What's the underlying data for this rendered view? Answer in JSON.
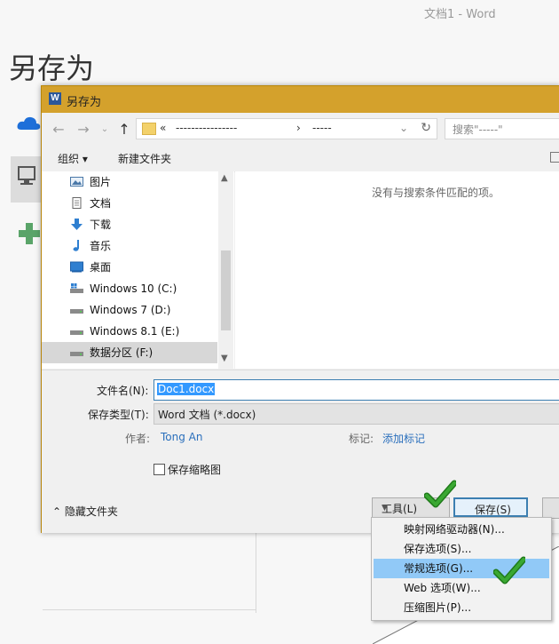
{
  "backstage": {
    "window_title": "文档1 - Word",
    "heading": "另存为"
  },
  "dialog": {
    "title": "另存为",
    "app_icon_letter": "W",
    "address": {
      "lead": "«",
      "crumb1": "----------------",
      "sep": "›",
      "crumb2": "-----"
    },
    "search_placeholder": "搜索\"-----\"",
    "toolbar": {
      "organize": "组织 ▾",
      "new_folder": "新建文件夹"
    },
    "nav_items": [
      {
        "label": "图片",
        "icon": "pictures-icon"
      },
      {
        "label": "文档",
        "icon": "documents-icon"
      },
      {
        "label": "下载",
        "icon": "downloads-icon"
      },
      {
        "label": "音乐",
        "icon": "music-icon"
      },
      {
        "label": "桌面",
        "icon": "desktop-icon"
      },
      {
        "label": "Windows 10 (C:)",
        "icon": "system-drive-icon"
      },
      {
        "label": "Windows 7 (D:)",
        "icon": "drive-icon"
      },
      {
        "label": "Windows 8.1 (E:)",
        "icon": "drive-icon"
      },
      {
        "label": "数据分区 (F:)",
        "icon": "drive-icon",
        "selected": true
      }
    ],
    "empty_message": "没有与搜索条件匹配的项。",
    "form": {
      "filename_label": "文件名(N):",
      "filename_value": "Doc1.docx",
      "filetype_label": "保存类型(T):",
      "filetype_value": "Word 文档 (*.docx)",
      "author_label": "作者:",
      "author_value": "Tong An",
      "tags_label": "标记:",
      "tags_value": "添加标记",
      "thumbnail_label": "保存缩略图",
      "thumbnail_checked": false
    },
    "hide_folders": "隐藏文件夹",
    "tools_button": "工具(L)",
    "save_button": "保存(S)"
  },
  "tools_menu": {
    "items": [
      {
        "label": "映射网络驱动器(N)..."
      },
      {
        "label": "保存选项(S)..."
      },
      {
        "label": "常规选项(G)...",
        "highlighted": true
      },
      {
        "label": "Web 选项(W)..."
      },
      {
        "label": "压缩图片(P)..."
      }
    ]
  },
  "colors": {
    "titlebar": "#d4a12c",
    "accent": "#3c7fb1",
    "selection": "#3399ff",
    "menu_highlight": "#91c9f7",
    "checkmark": "#3aa832"
  }
}
